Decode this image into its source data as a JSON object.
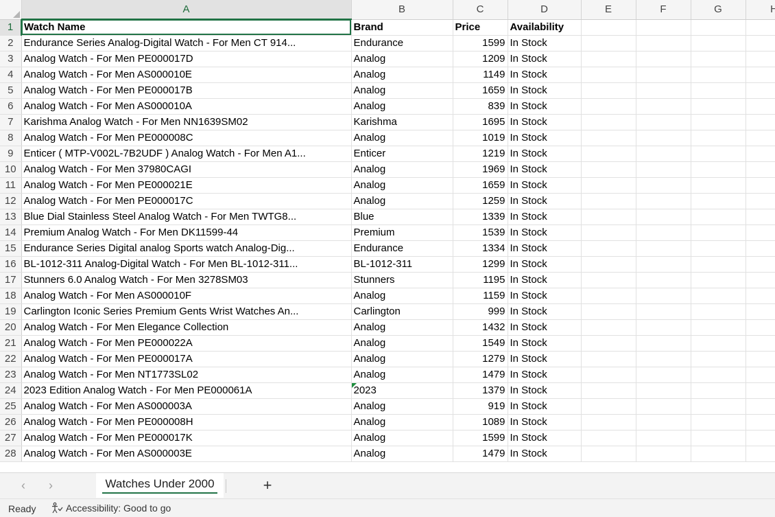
{
  "columns": [
    "A",
    "B",
    "C",
    "D",
    "E",
    "F",
    "G",
    "H"
  ],
  "selected_column": "A",
  "selected_row": "1",
  "rows": [
    {
      "n": "1",
      "a": "Watch Name",
      "b": "Brand",
      "c": "Price",
      "d": "Availability"
    },
    {
      "n": "2",
      "a": "Endurance Series Analog-Digital Watch  - For Men CT 914...",
      "b": "Endurance",
      "c": "1599",
      "d": "In Stock"
    },
    {
      "n": "3",
      "a": "Analog Watch  - For Men PE000017D",
      "b": "Analog",
      "c": "1209",
      "d": "In Stock"
    },
    {
      "n": "4",
      "a": "Analog Watch  - For Men AS000010E",
      "b": "Analog",
      "c": "1149",
      "d": "In Stock"
    },
    {
      "n": "5",
      "a": "Analog Watch  - For Men PE000017B",
      "b": "Analog",
      "c": "1659",
      "d": "In Stock"
    },
    {
      "n": "6",
      "a": "Analog Watch  - For Men AS000010A",
      "b": "Analog",
      "c": "839",
      "d": "In Stock"
    },
    {
      "n": "7",
      "a": "Karishma Analog Watch  - For Men NN1639SM02",
      "b": "Karishma",
      "c": "1695",
      "d": "In Stock"
    },
    {
      "n": "8",
      "a": "Analog Watch  - For Men PE000008C",
      "b": "Analog",
      "c": "1019",
      "d": "In Stock"
    },
    {
      "n": "9",
      "a": "Enticer ( MTP-V002L-7B2UDF ) Analog Watch  - For Men A1...",
      "b": "Enticer",
      "c": "1219",
      "d": "In Stock"
    },
    {
      "n": "10",
      "a": "Analog Watch  - For Men 37980CAGI",
      "b": "Analog",
      "c": "1969",
      "d": "In Stock"
    },
    {
      "n": "11",
      "a": "Analog Watch  - For Men PE000021E",
      "b": "Analog",
      "c": "1659",
      "d": "In Stock"
    },
    {
      "n": "12",
      "a": "Analog Watch  - For Men PE000017C",
      "b": "Analog",
      "c": "1259",
      "d": "In Stock"
    },
    {
      "n": "13",
      "a": "Blue Dial Stainless Steel Analog Watch  - For Men TWTG8...",
      "b": "Blue",
      "c": "1339",
      "d": "In Stock"
    },
    {
      "n": "14",
      "a": "Premium Analog Watch  - For Men DK11599-44",
      "b": "Premium",
      "c": "1539",
      "d": "In Stock"
    },
    {
      "n": "15",
      "a": "Endurance Series Digital analog Sports watch Analog-Dig...",
      "b": "Endurance",
      "c": "1334",
      "d": "In Stock"
    },
    {
      "n": "16",
      "a": "BL-1012-311 Analog-Digital Watch  - For Men BL-1012-311...",
      "b": "BL-1012-311",
      "c": "1299",
      "d": "In Stock"
    },
    {
      "n": "17",
      "a": "Stunners 6.0 Analog Watch  - For Men 3278SM03",
      "b": "Stunners",
      "c": "1195",
      "d": "In Stock"
    },
    {
      "n": "18",
      "a": "Analog Watch  - For Men AS000010F",
      "b": "Analog",
      "c": "1159",
      "d": "In Stock"
    },
    {
      "n": "19",
      "a": "Carlington Iconic Series Premium Gents Wrist Watches An...",
      "b": "Carlington",
      "c": "999",
      "d": "In Stock"
    },
    {
      "n": "20",
      "a": "Analog Watch  - For Men Elegance Collection",
      "b": "Analog",
      "c": "1432",
      "d": "In Stock"
    },
    {
      "n": "21",
      "a": "Analog Watch  - For Men PE000022A",
      "b": "Analog",
      "c": "1549",
      "d": "In Stock"
    },
    {
      "n": "22",
      "a": "Analog Watch  - For Men PE000017A",
      "b": "Analog",
      "c": "1279",
      "d": "In Stock"
    },
    {
      "n": "23",
      "a": "Analog Watch  - For Men NT1773SL02",
      "b": "Analog",
      "c": "1479",
      "d": "In Stock"
    },
    {
      "n": "24",
      "a": "2023 Edition Analog Watch  - For Men PE000061A",
      "b": "2023",
      "c": "1379",
      "d": "In Stock"
    },
    {
      "n": "25",
      "a": "Analog Watch  - For Men AS000003A",
      "b": "Analog",
      "c": "919",
      "d": "In Stock"
    },
    {
      "n": "26",
      "a": "Analog Watch  - For Men PE000008H",
      "b": "Analog",
      "c": "1089",
      "d": "In Stock"
    },
    {
      "n": "27",
      "a": "Analog Watch  - For Men PE000017K",
      "b": "Analog",
      "c": "1599",
      "d": "In Stock"
    },
    {
      "n": "28",
      "a": "Analog Watch  - For Men AS000003E",
      "b": "Analog",
      "c": "1479",
      "d": "In Stock"
    }
  ],
  "tabs": {
    "prev_icon": "chevron-left-icon",
    "next_icon": "chevron-right-icon",
    "active_sheet": "Watches Under 2000",
    "add_label": "+"
  },
  "status": {
    "ready": "Ready",
    "accessibility": "Accessibility: Good to go"
  },
  "colors": {
    "accent": "#217346",
    "grid_line": "#e1e1e1",
    "header_bg": "#f5f5f5"
  }
}
